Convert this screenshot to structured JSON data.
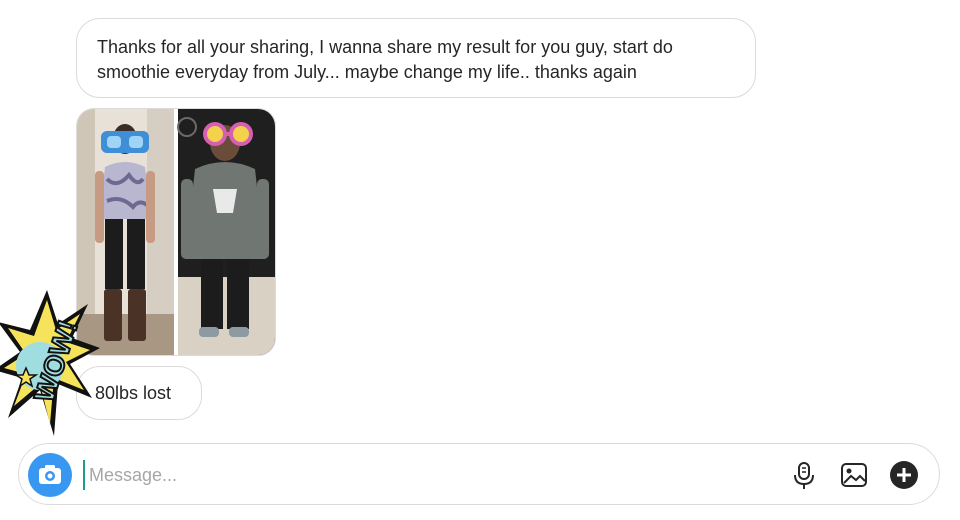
{
  "conversation": {
    "messages": [
      {
        "type": "text",
        "text": "Thanks for all your sharing, I wanna share my result for you guy, start do smoothie everyday from July... maybe change my life.. thanks again"
      },
      {
        "type": "photo"
      },
      {
        "type": "text",
        "text": "80lbs lost"
      }
    ]
  },
  "sticker": {
    "text": "WOW!"
  },
  "composer": {
    "placeholder": "Message...",
    "value": "",
    "icons": {
      "camera": "camera-icon",
      "mic": "microphone-icon",
      "gallery": "image-gallery-icon",
      "add": "plus-circle-icon"
    }
  },
  "colors": {
    "bubble_border": "#dbdbdb",
    "camera_blue": "#3897f0",
    "placeholder": "#a6a6a6",
    "cursor": "#1a9e8c"
  }
}
